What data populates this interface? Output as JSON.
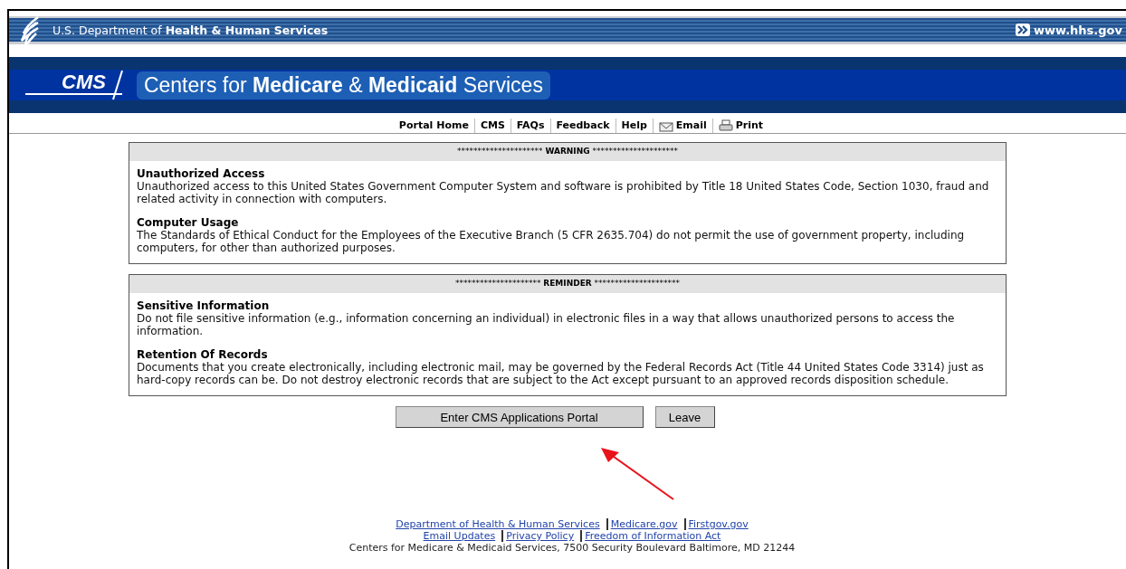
{
  "hhs_bar": {
    "title": "U.S. Department of **Health & Human Services**",
    "link": "www.hhs.gov"
  },
  "cms_banner": {
    "logo": "CMS",
    "title": "Centers for **Medicare** & **Medicaid** Services"
  },
  "nav": [
    {
      "label": "Portal Home",
      "kind": "text"
    },
    {
      "label": "CMS",
      "kind": "text"
    },
    {
      "label": "FAQs",
      "kind": "text"
    },
    {
      "label": "Feedback",
      "kind": "text"
    },
    {
      "label": "Help",
      "kind": "text"
    },
    {
      "label": "Email",
      "kind": "email"
    },
    {
      "label": "Print",
      "kind": "print"
    }
  ],
  "notices": [
    {
      "heading": {
        "prefix": "*********************",
        "label": "WARNING",
        "suffix": "*********************"
      },
      "sections": [
        {
          "title": "Unauthorized Access",
          "body": "Unauthorized access to this United States Government Computer System and software is prohibited by Title 18 United States Code, Section 1030, fraud and related activity in connection with computers."
        },
        {
          "title": "Computer Usage",
          "body": "The Standards of Ethical Conduct for the Employees of the Executive Branch (5 CFR 2635.704) do not permit the use of government property, including computers, for other than authorized purposes."
        }
      ]
    },
    {
      "heading": {
        "prefix": "*********************",
        "label": "REMINDER",
        "suffix": "*********************"
      },
      "sections": [
        {
          "title": "Sensitive Information",
          "body": "Do not file sensitive information (e.g., information concerning an individual) in electronic files in a way that allows unauthorized persons to access the information."
        },
        {
          "title": "Retention Of Records",
          "body": "Documents that you create electronically, including electronic mail, may be governed by the Federal Records Act (Title 44 United States Code 3314) just as hard-copy records can be. Do not destroy electronic records that are subject to the Act except pursuant to an approved records disposition schedule."
        }
      ]
    }
  ],
  "buttons": [
    {
      "label": "Enter CMS Applications Portal",
      "kind": "wide"
    },
    {
      "label": "Leave",
      "kind": "narrow"
    }
  ],
  "footer": {
    "link_rows": [
      [
        "Department of Health & Human Services",
        "Medicare.gov",
        "Firstgov.gov"
      ],
      [
        "Email Updates",
        "Privacy Policy",
        "Freedom of Information Act"
      ]
    ],
    "address": "Centers for Medicare & Medicaid Services, 7500 Security Boulevard Baltimore, MD 21244"
  }
}
